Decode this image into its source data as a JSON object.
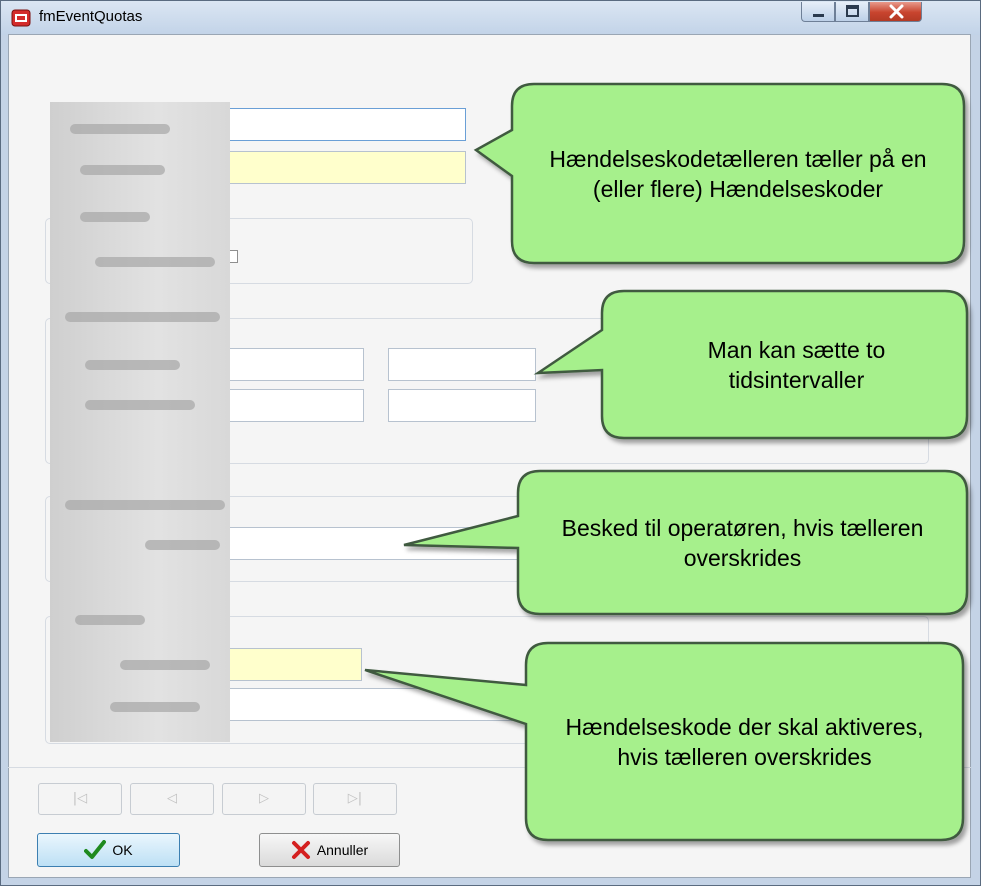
{
  "window": {
    "title": "fmEventQuotas"
  },
  "navigation": {
    "first_label": "|◁",
    "prev_label": "◁",
    "next_label": "▷",
    "last_label": "▷|"
  },
  "actions": {
    "ok_label": "OK",
    "cancel_label": "Annuller"
  },
  "callouts": [
    {
      "text": "Hændelseskodetælleren tæller på en (eller flere) Hændelseskoder"
    },
    {
      "text": "Man kan sætte to tidsintervaller"
    },
    {
      "text": "Besked til operatøren, hvis tælleren overskrides"
    },
    {
      "text": "Hændelseskode der skal aktiveres, hvis tælleren overskrides"
    }
  ],
  "colors": {
    "callout_fill": "#a6f08c",
    "callout_border": "#3f5a3f",
    "required_field": "#ffffcc"
  }
}
